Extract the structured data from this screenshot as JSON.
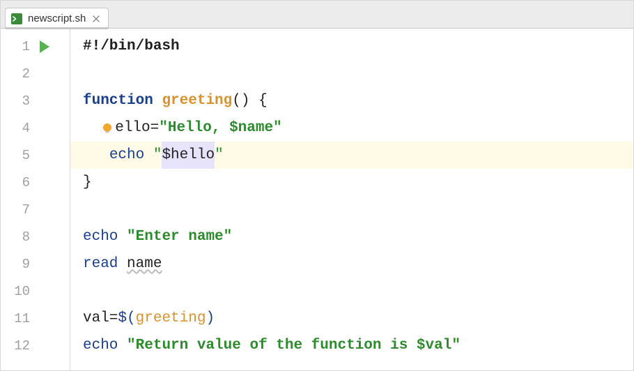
{
  "tab": {
    "filename": "newscript.sh",
    "icon": "shell-file-icon",
    "close_label": "×"
  },
  "lines": [
    "1",
    "2",
    "3",
    "4",
    "5",
    "6",
    "7",
    "8",
    "9",
    "10",
    "11",
    "12"
  ],
  "run_gutter_line": 1,
  "highlight_line": 5,
  "code": {
    "l1_shabang": "#!/bin/bash",
    "l3_function": "function",
    "l3_funcname": "greeting",
    "l3_paren_open": "(",
    "l3_paren_close": ")",
    "l3_brace_open": " {",
    "l4_indent": "  ",
    "l4_assign_lhs": "ello=",
    "l4_str_open": "\"",
    "l4_str_text": "Hello, ",
    "l4_str_var": "$name",
    "l4_str_close": "\"",
    "l5_indent": "   ",
    "l5_echo": "echo",
    "l5_space": " ",
    "l5_str_open": "\"",
    "l5_var": "$hello",
    "l5_str_close": "\"",
    "l6_brace_close": "}",
    "l8_echo": "echo",
    "l8_space": " ",
    "l8_str": "\"Enter name\"",
    "l9_read": "read",
    "l9_space": " ",
    "l9_name": "name",
    "l11_lhs": "val=",
    "l11_sub_open": "$(",
    "l11_sub_name": "greeting",
    "l11_sub_close": ")",
    "l12_echo": "echo",
    "l12_space": " ",
    "l12_str_open": "\"",
    "l12_str_text": "Return value of the function is ",
    "l12_var": "$val",
    "l12_str_close": "\""
  }
}
